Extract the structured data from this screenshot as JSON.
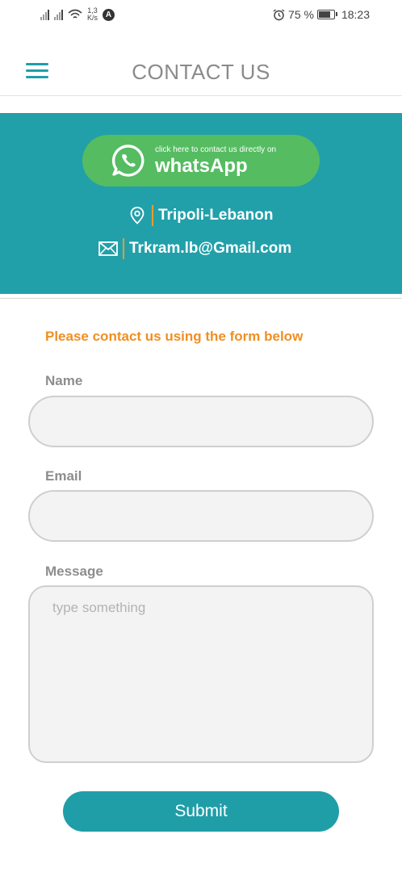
{
  "status_bar": {
    "speed_value": "1,3",
    "speed_unit": "K/s",
    "nav_badge": "A",
    "battery": "75 %",
    "time": "18:23"
  },
  "header": {
    "title": "CONTACT US"
  },
  "banner": {
    "whatsapp_hint": "click here to contact us directly on",
    "whatsapp_label": "whatsApp",
    "location": "Tripoli-Lebanon",
    "email": "Trkram.lb@Gmail.com"
  },
  "form": {
    "intro": "Please contact us using the form below",
    "name_label": "Name",
    "email_label": "Email",
    "message_label": "Message",
    "message_placeholder": "type something",
    "submit_label": "Submit"
  },
  "colors": {
    "primary": "#1f9ea8",
    "banner": "#21a0aa",
    "whatsapp": "#55bc61",
    "accent": "#ef8f22"
  }
}
